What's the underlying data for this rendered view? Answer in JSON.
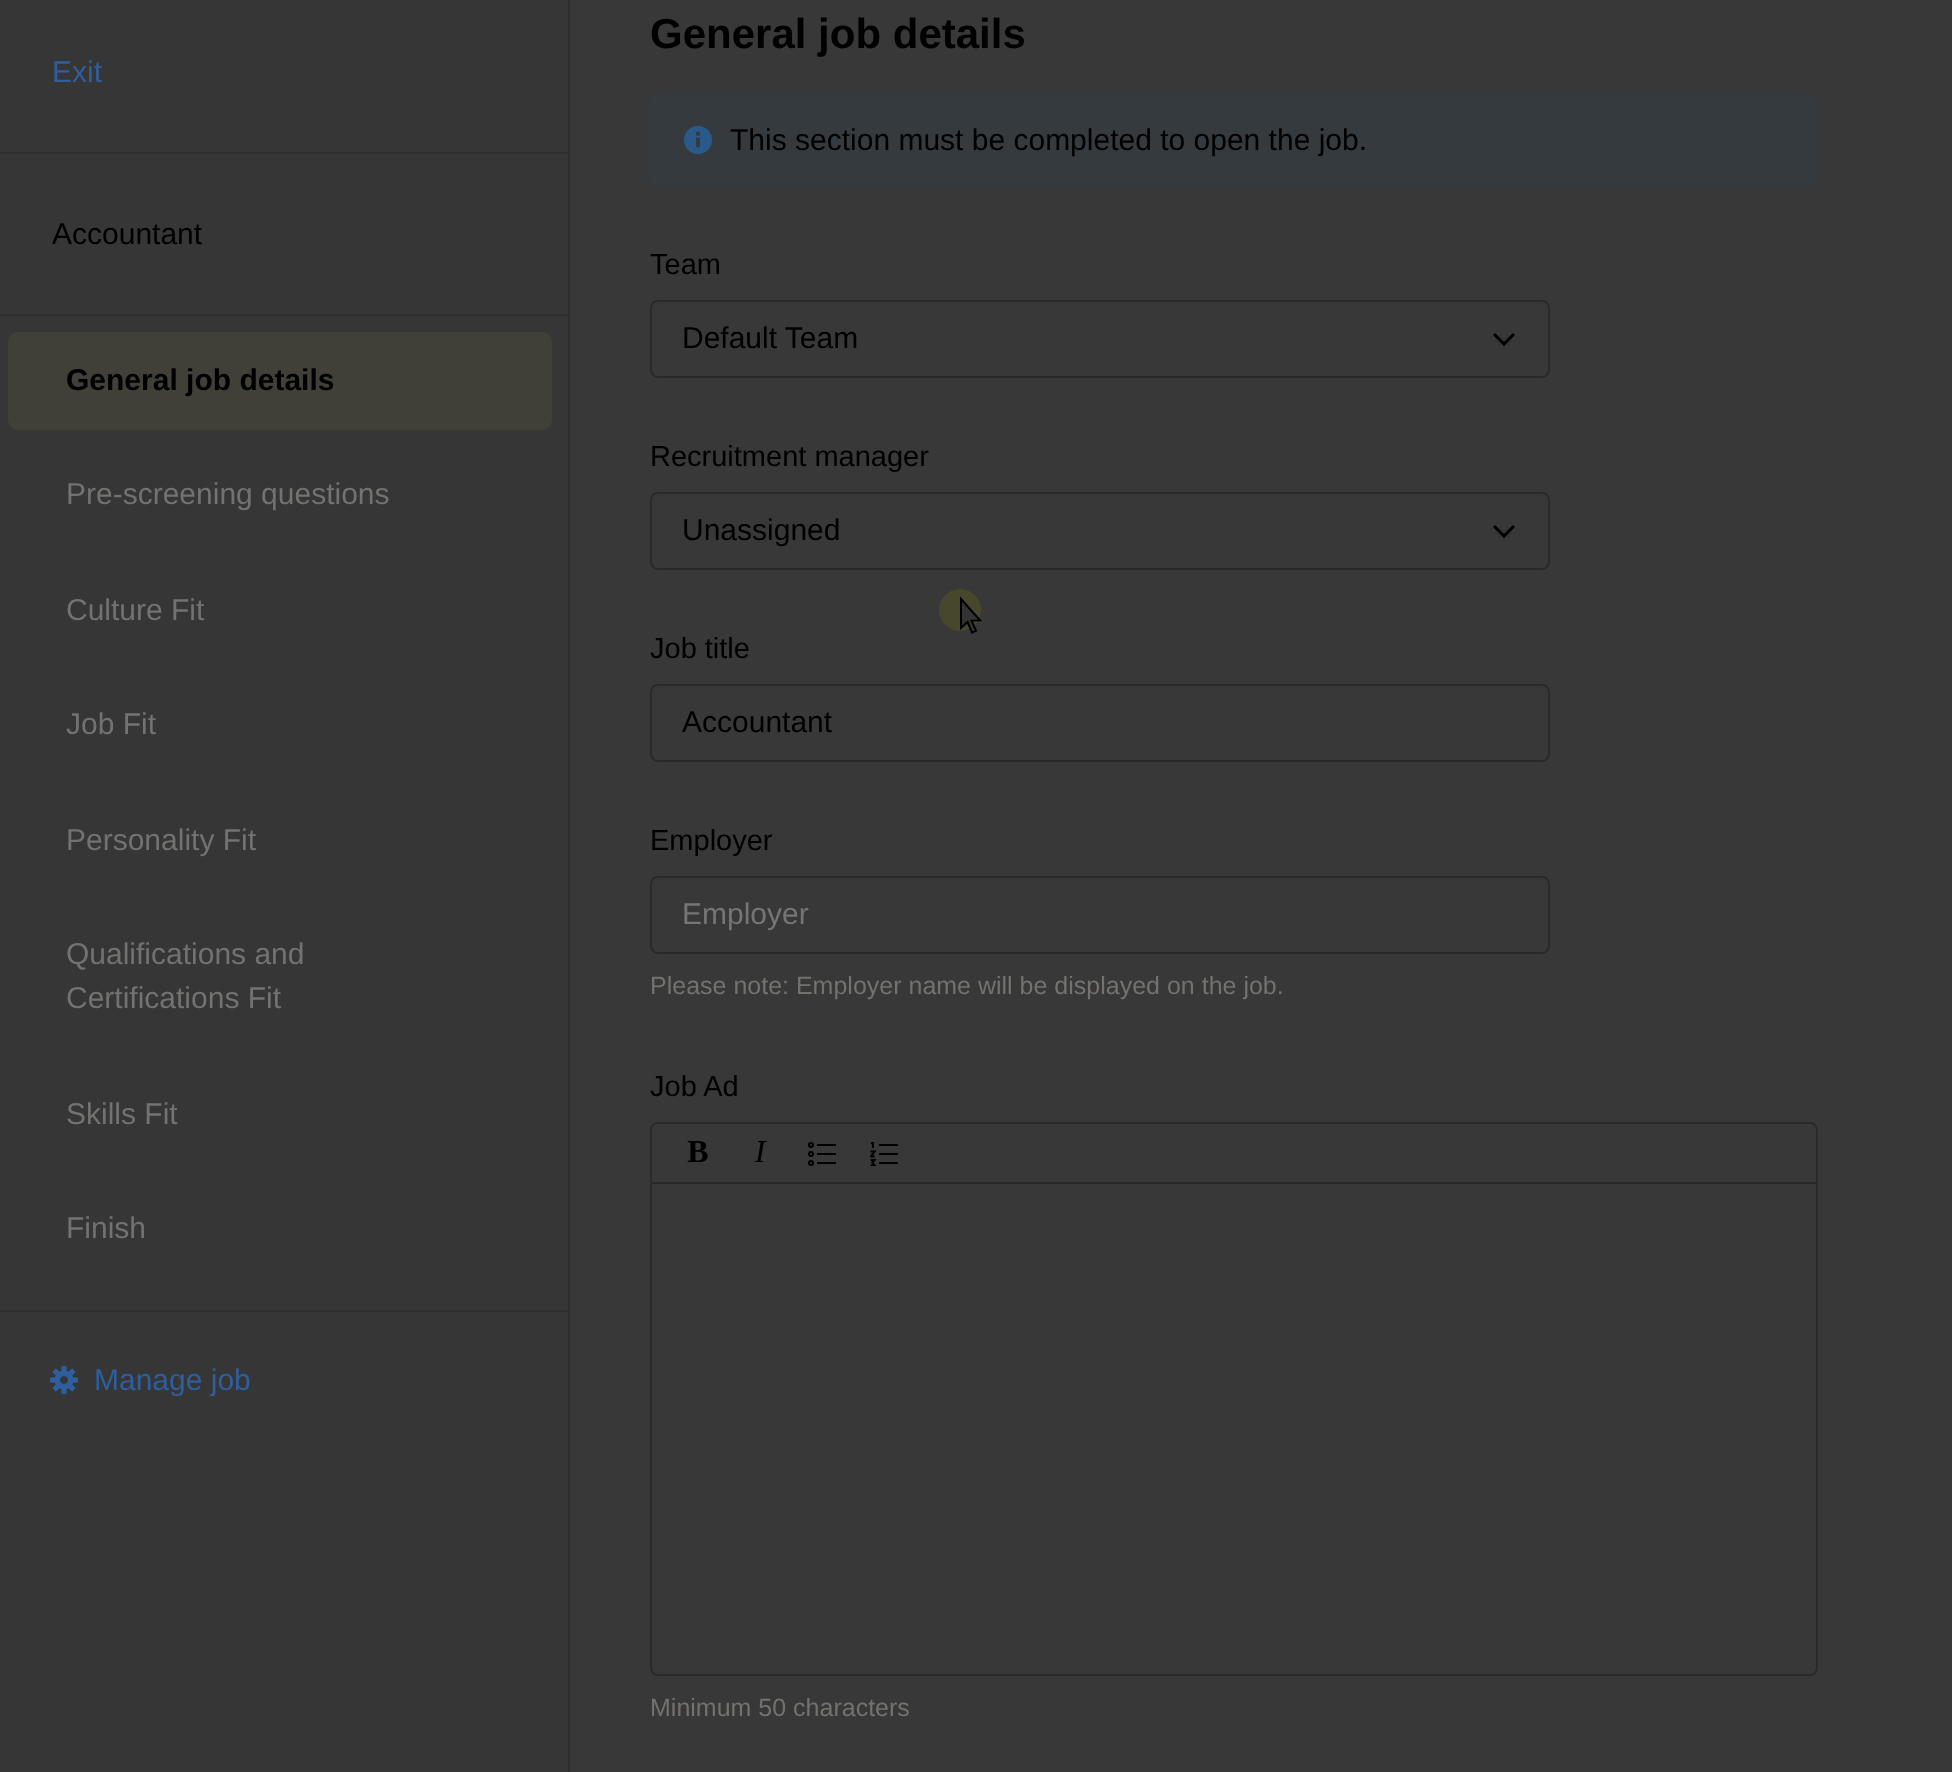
{
  "sidebar": {
    "exit": "Exit",
    "job_name": "Accountant",
    "steps": [
      {
        "label": "General job details",
        "selected": true
      },
      {
        "label": "Pre-screening questions",
        "selected": false
      },
      {
        "label": "Culture Fit",
        "selected": false
      },
      {
        "label": "Job Fit",
        "selected": false
      },
      {
        "label": "Personality Fit",
        "selected": false
      },
      {
        "label": "Qualifications and Certifications Fit",
        "selected": false
      },
      {
        "label": "Skills Fit",
        "selected": false
      },
      {
        "label": "Finish",
        "selected": false
      }
    ],
    "manage": "Manage job"
  },
  "main": {
    "title": "General job details",
    "notice": "This section must be completed to open the job.",
    "fields": [
      {
        "kind": "select",
        "label": "Team",
        "value": "Default Team"
      },
      {
        "kind": "select",
        "label": "Recruitment manager",
        "value": "Unassigned"
      },
      {
        "kind": "text",
        "label": "Job title",
        "value": "Accountant"
      },
      {
        "kind": "text",
        "label": "Employer",
        "placeholder": "Employer",
        "note": "Please note: Employer name will be displayed on the job."
      },
      {
        "kind": "editor",
        "label": "Job Ad",
        "toolbar": [
          {
            "kind": "bold",
            "label": "B"
          },
          {
            "kind": "italic",
            "label": "I"
          },
          {
            "kind": "bullet_list"
          },
          {
            "kind": "numbered_list"
          }
        ],
        "note": "Minimum 50 characters"
      }
    ]
  }
}
